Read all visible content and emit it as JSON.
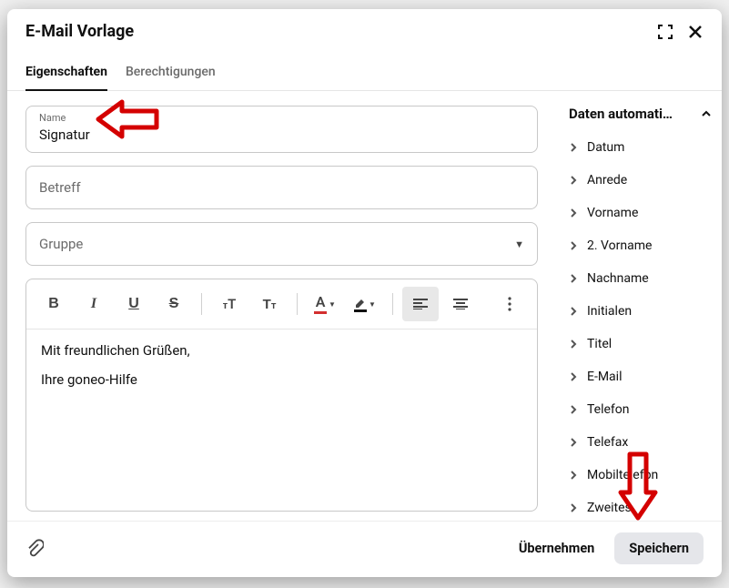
{
  "header": {
    "title": "E-Mail Vorlage"
  },
  "tabs": {
    "properties": "Eigenschaften",
    "permissions": "Berechtigungen"
  },
  "form": {
    "name_label": "Name",
    "name_value": "Signatur",
    "subject_placeholder": "Betreff",
    "group_placeholder": "Gruppe"
  },
  "editor": {
    "line1": "Mit freundlichen Grüßen,",
    "line2": "Ihre goneo-Hilfe"
  },
  "sidebar": {
    "title": "Daten automati…",
    "items": [
      "Datum",
      "Anrede",
      "Vorname",
      "2. Vorname",
      "Nachname",
      "Initialen",
      "Titel",
      "E-Mail",
      "Telefon",
      "Telefax",
      "Mobiltelefon",
      "Zweites"
    ]
  },
  "footer": {
    "apply": "Übernehmen",
    "save": "Speichern"
  }
}
